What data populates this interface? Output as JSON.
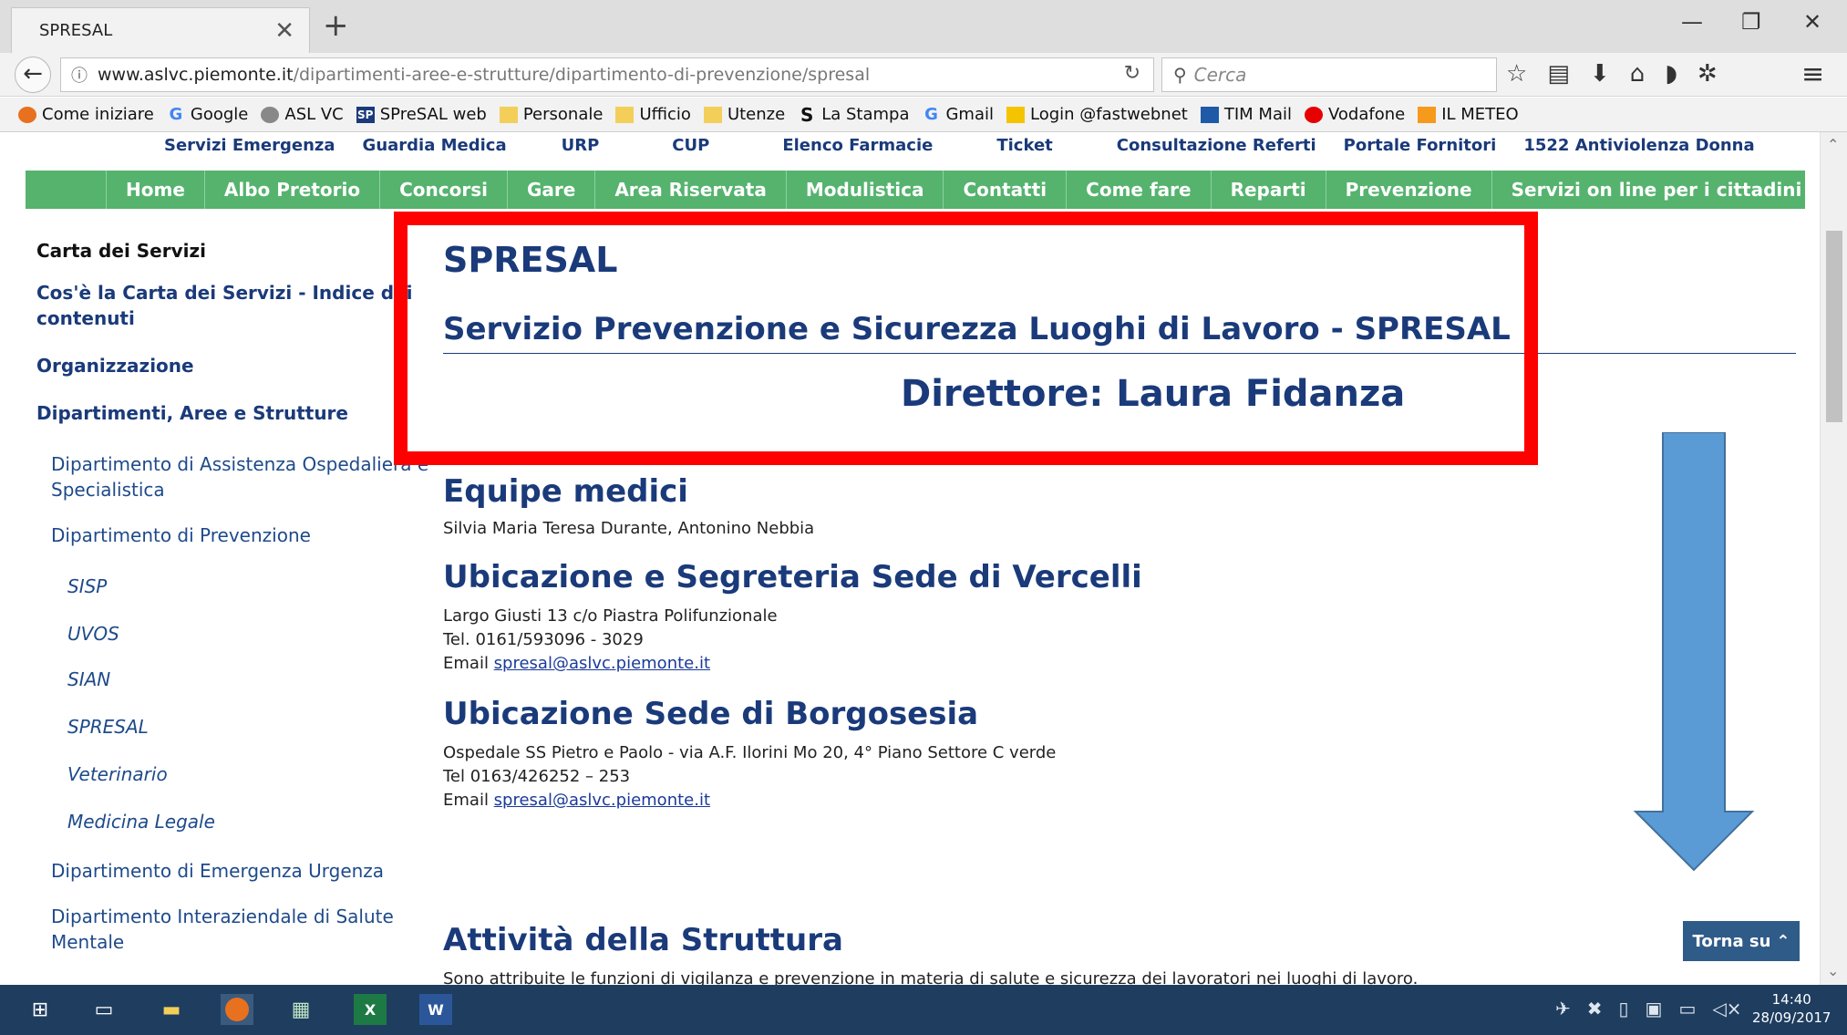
{
  "browser": {
    "tab_title": "SPRESAL",
    "url_host": "www.aslvc.piemonte.it",
    "url_path": "/dipartimenti-aree-e-strutture/dipartimento-di-prevenzione/spresal",
    "search_placeholder": "Cerca",
    "bookmarks": [
      {
        "label": "Come iniziare",
        "icon": "firefox-icon"
      },
      {
        "label": "Google",
        "icon": "google-icon"
      },
      {
        "label": "ASL VC",
        "icon": "globe-icon"
      },
      {
        "label": "SPreSAL web",
        "icon": "sp-icon"
      },
      {
        "label": "Personale",
        "icon": "folder-icon"
      },
      {
        "label": "Ufficio",
        "icon": "folder-icon"
      },
      {
        "label": "Utenze",
        "icon": "folder-icon"
      },
      {
        "label": "La Stampa",
        "icon": "stampa-icon"
      },
      {
        "label": "Gmail",
        "icon": "google-icon"
      },
      {
        "label": "Login @fastwebnet",
        "icon": "fastweb-icon"
      },
      {
        "label": "TIM Mail",
        "icon": "mail-icon"
      },
      {
        "label": "Vodafone",
        "icon": "vodafone-icon"
      },
      {
        "label": "IL METEO",
        "icon": "meteo-icon"
      }
    ]
  },
  "site": {
    "quick_links": [
      "Servizi Emergenza",
      "Guardia Medica",
      "URP",
      "CUP",
      "Elenco Farmacie",
      "Ticket",
      "Consultazione Referti",
      "Portale Fornitori",
      "1522 Antiviolenza Donna"
    ],
    "main_nav": [
      "Home",
      "Albo Pretorio",
      "Concorsi",
      "Gare",
      "Area Riservata",
      "Modulistica",
      "Contatti",
      "Come fare",
      "Reparti",
      "Prevenzione",
      "Servizi on line per i cittadini"
    ]
  },
  "sidebar": {
    "heading": "Carta dei Servizi",
    "item1": "Cos'è la Carta dei Servizi - Indice dei",
    "item1b": "contenuti",
    "item2": "Organizzazione",
    "item3": "Dipartimenti, Aree e Strutture",
    "sub1": "Dipartimento di Assistenza Ospedaliera e",
    "sub1b": "Specialistica",
    "sub2": "Dipartimento di Prevenzione",
    "leaf": [
      "SISP",
      "UVOS",
      "SIAN",
      "SPRESAL",
      "Veterinario",
      "Medicina Legale"
    ],
    "sub3": "Dipartimento di Emergenza Urgenza",
    "sub4": "Dipartimento Interaziendale di Salute",
    "sub4b": "Mentale"
  },
  "main": {
    "title": "SPRESAL",
    "subtitle": "Servizio Prevenzione e Sicurezza Luoghi di Lavoro - SPRESAL",
    "director": "Direttore: Laura Fidanza",
    "equipe_title": "Equipe medici",
    "equipe_names": "Silvia Maria Teresa Durante, Antonino Nebbia",
    "vercelli_title": "Ubicazione e Segreteria Sede di Vercelli",
    "vercelli_address": "Largo Giusti 13 c/o Piastra Polifunzionale",
    "vercelli_tel": "Tel. 0161/593096 - 3029",
    "vercelli_email_label": "Email ",
    "vercelli_email": "spresal@aslvc.piemonte.it",
    "borgosesia_title": "Ubicazione Sede di Borgosesia",
    "borgosesia_address": "Ospedale SS Pietro e Paolo - via A.F. Ilorini Mo 20,  4° Piano Settore C verde",
    "borgosesia_tel": "Tel 0163/426252 – 253",
    "borgosesia_email_label": "Email ",
    "borgosesia_email": "spresal@aslvc.piemonte.it",
    "attivita_title": "Attività della Struttura",
    "attivita_text": "Sono attribuite le funzioni di vigilanza e prevenzione in materia di salute e sicurezza dei lavoratori nei luoghi di lavoro.",
    "torna_su": "Torna su"
  },
  "taskbar": {
    "time": "14:40",
    "date": "28/09/2017"
  },
  "colors": {
    "green_nav": "#55b36e",
    "heading_blue": "#1a3a7a",
    "highlight_red": "#ff0000",
    "arrow_blue": "#5b9bd5",
    "taskbar": "#1e3d5f"
  }
}
